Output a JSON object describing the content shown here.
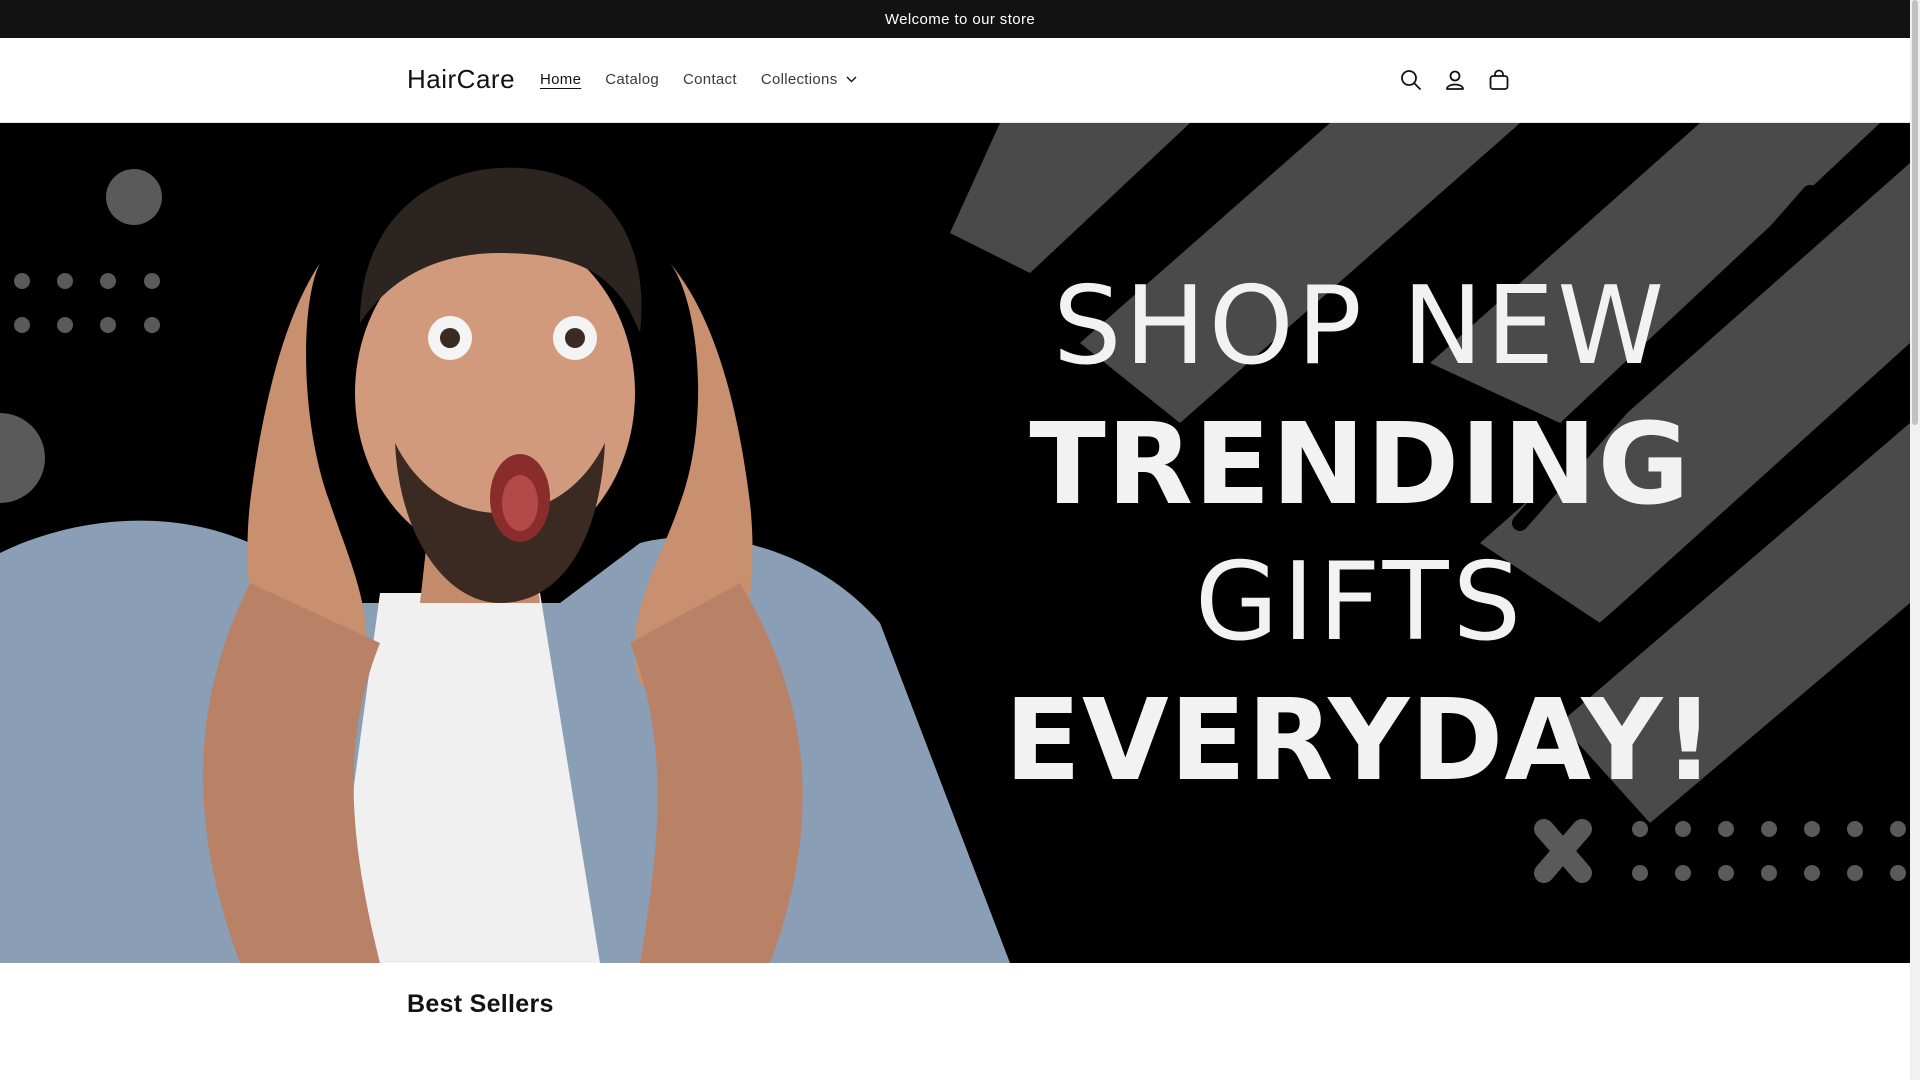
{
  "announcement": {
    "text": "Welcome to our store"
  },
  "header": {
    "logo": "HairCare",
    "nav": [
      {
        "label": "Home",
        "active": true
      },
      {
        "label": "Catalog",
        "active": false
      },
      {
        "label": "Contact",
        "active": false
      },
      {
        "label": "Collections",
        "active": false,
        "has_dropdown": true
      }
    ],
    "icons": [
      "search-icon",
      "account-icon",
      "cart-icon"
    ]
  },
  "hero": {
    "lines": [
      "SHOP NEW",
      "TRENDING",
      "GIFTS",
      "EVERYDAY!"
    ],
    "background": "#000000",
    "text_color": "#f2f2f2",
    "image": "surprised-man-photo"
  },
  "section": {
    "title": "Best Sellers"
  }
}
